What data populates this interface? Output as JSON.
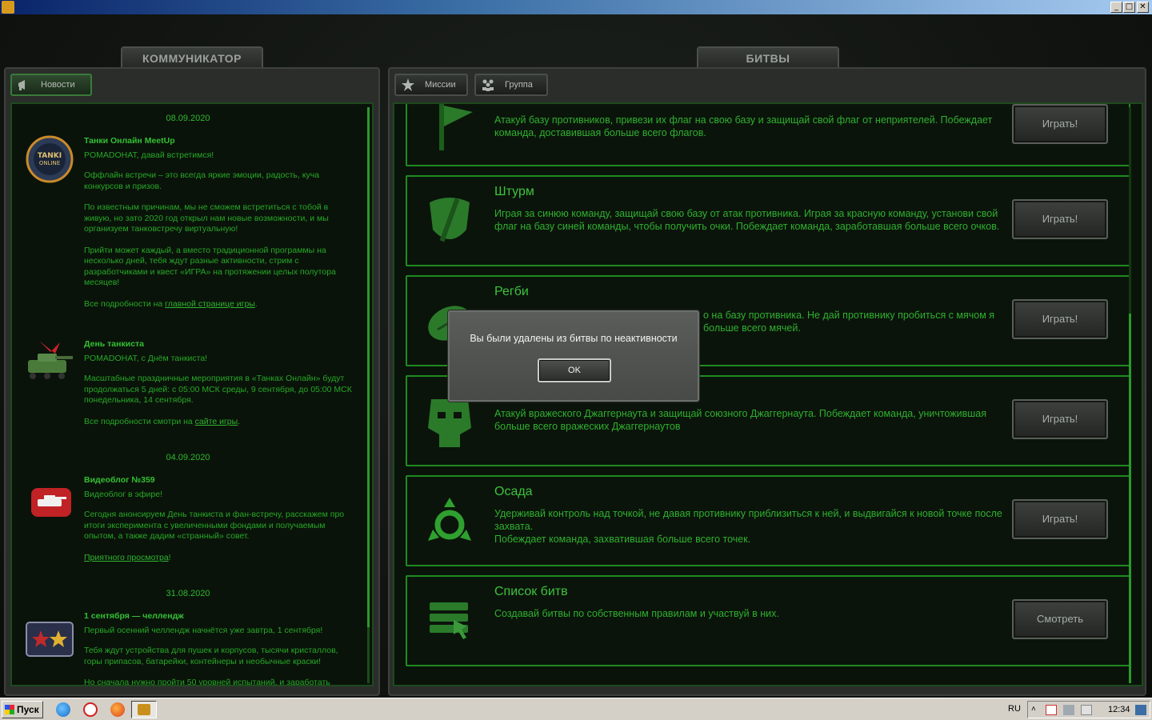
{
  "window": {
    "minimize": "_",
    "maximize": "□",
    "close": "✕"
  },
  "left_panel": {
    "tab_title": "КОММУНИКАТОР",
    "news_button": "Новости",
    "news": [
      {
        "date": "08.09.2020"
      },
      {
        "title": "Танки Онлайн MeetUp",
        "subtitle": "POMADOHAT, давай встретимся!",
        "paragraphs": [
          "Оффлайн встречи – это всегда яркие эмоции, радость, куча конкурсов и призов.",
          "По известным причинам, мы не сможем встретиться с тобой в живую, но зато 2020 год открыл нам новые возможности, и мы организуем танковстречу виртуальную!",
          "Прийти может каждый, а вместо традиционной программы на несколько дней, тебя ждут разные активности, стрим с разработчиками и квест «ИГРА» на протяжении целых полутора месяцев!"
        ],
        "more_prefix": "Все подробности на ",
        "more_link": "главной странице игры",
        "more_suffix": "."
      },
      {
        "title": "День танкиста",
        "subtitle": "POMADOHAT, с Днём танкиста!",
        "paragraphs": [
          "Масштабные праздничные мероприятия в «Танках Онлайн» будут продолжаться 5 дней: с 05:00 МСК среды, 9 сентября, до 05:00 МСК понедельника, 14 сентября."
        ],
        "more_prefix": "Все подробности смотри на  ",
        "more_link": "сайте игры",
        "more_suffix": "."
      },
      {
        "date": "04.09.2020"
      },
      {
        "title": "Видеоблог №359",
        "subtitle": "Видеоблог в эфире!",
        "paragraphs": [
          "Сегодня анонсируем День танкиста и фан-встречу, расскажем про итоги эксперимента с увеличенными фондами и получаемым опытом, а также дадим «странный» совет."
        ],
        "more_prefix": " ",
        "more_link": "Приятного просмотра",
        "more_suffix": "!"
      },
      {
        "date": "31.08.2020"
      },
      {
        "title": "1 сентября — челлендж",
        "subtitle": "Первый осенний челлендж начнётся уже завтра, 1 сентября!",
        "paragraphs": [
          "Тебя ждут устройства для пушек и корпусов, тысячи кристаллов, горы припасов, батарейки, контейнеры и необычные краски!",
          "Но сначала нужно пройти 50 уровней испытаний, и заработать"
        ]
      }
    ],
    "thumb_logo_text": "TANKI ONLINE MeetUp"
  },
  "right_panel": {
    "tab_title": "БИТВЫ",
    "missions_button": "Миссии",
    "group_button": "Группа",
    "battles": [
      {
        "title": "",
        "desc": "Атакуй базу противников, привези их флаг на свою базу и защищай свой флаг от неприятелей. Побеждает команда, доставившая больше всего флагов.",
        "action": "Играть!",
        "icon": "flag-icon"
      },
      {
        "title": "Штурм",
        "desc": "Играя за синюю команду, защищай свою базу от атак противника. Играя за красную команду, установи свой флаг на базу синей команды, чтобы получить очки. Побеждает команда, заработавшая больше всего очков.",
        "action": "Играть!",
        "icon": "shield-sword-icon"
      },
      {
        "title": "Регби",
        "desc": "о на базу противника. Не дай противнику пробиться с мячом я больше всего мячей.",
        "action": "Играть!",
        "icon": "ball-icon"
      },
      {
        "title": "",
        "desc": "Атакуй вражеского Джаггернаута и защищай союзного Джаггернаута. Побеждает команда, уничтожившая больше всего вражеских Джаггернаутов",
        "action": "Играть!",
        "icon": "skull-icon"
      },
      {
        "title": "Осада",
        "desc": "Удерживай контроль над точкой, не давая противнику приблизиться к ней, и выдвигайся к новой точке после захвата.\nПобеждает команда, захватившая больше всего точек.",
        "action": "Играть!",
        "icon": "control-point-icon"
      },
      {
        "title": "Список битв",
        "desc": "Создавай битвы по собственным правилам и участвуй в них.",
        "action": "Смотреть",
        "icon": "battle-list-icon"
      }
    ]
  },
  "modal": {
    "message": "Вы были удалены из битвы по неактивности",
    "ok": "OK"
  },
  "taskbar": {
    "start": "Пуск",
    "lang": "RU",
    "clock": "12:34"
  },
  "colors": {
    "accent_green": "#2fb52f",
    "card_border": "#1f8a1f",
    "panel_bg": "#0a130a"
  }
}
